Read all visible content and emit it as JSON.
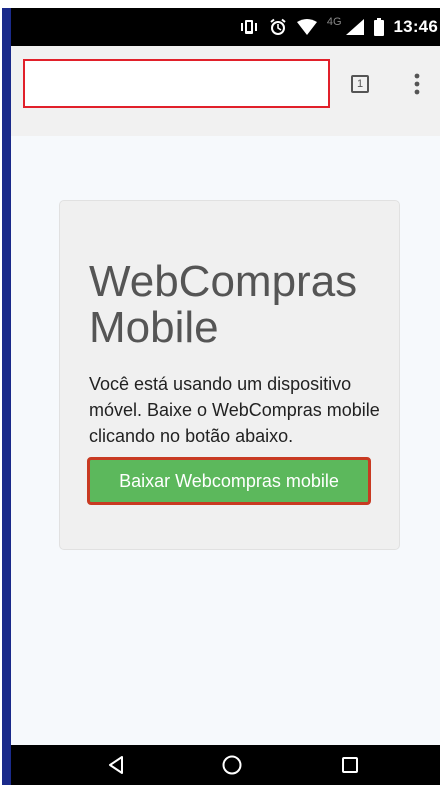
{
  "status_bar": {
    "time": "13:46",
    "network_type": "4G",
    "icons": [
      "vibrate-icon",
      "alarm-icon",
      "wifi-icon",
      "signal-icon",
      "battery-icon"
    ]
  },
  "toolbar": {
    "url": "",
    "tab_count": "1",
    "menu_icon": "more-vert-icon"
  },
  "card": {
    "title_line1": "WebCompras",
    "title_line2": "Mobile",
    "description": "Você está usando um dispositivo móvel. Baixe o WebCompras mobile clicando no botão abaixo.",
    "button_label": "Baixar Webcompras mobile"
  },
  "nav_bar": {
    "icons": [
      "back-icon",
      "home-icon",
      "recents-icon"
    ]
  },
  "colors": {
    "button_green": "#5cb85c",
    "highlight_red": "#e1202a",
    "frame_blue": "#1a2a8a"
  }
}
